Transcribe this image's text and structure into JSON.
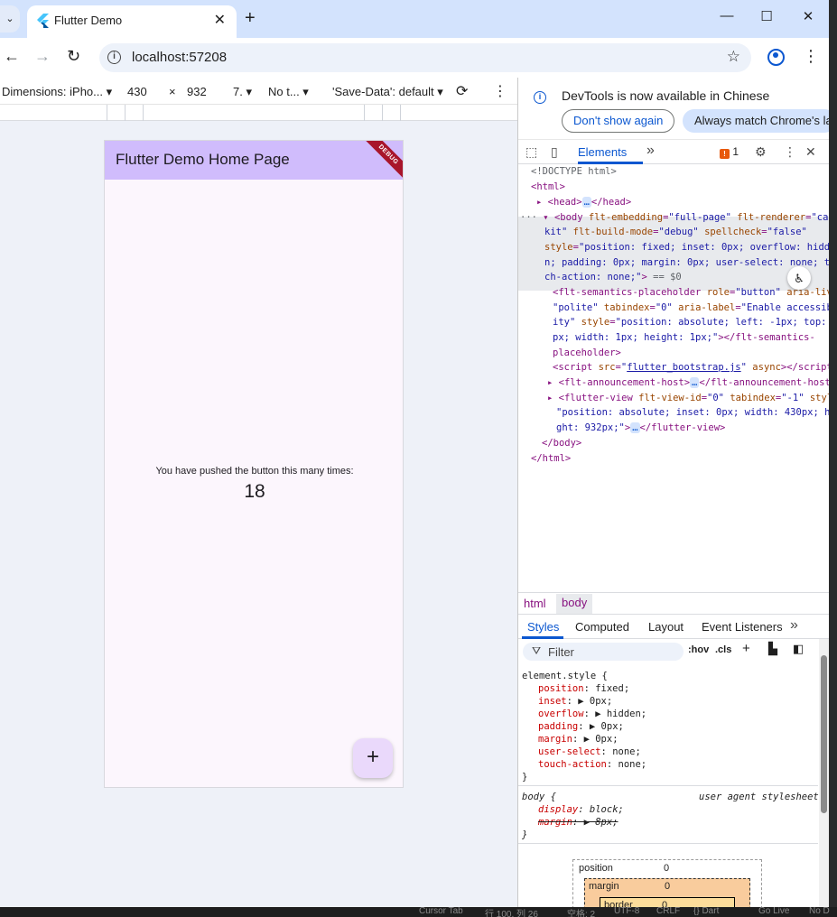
{
  "browser": {
    "tab_title": "Flutter Demo",
    "url": "localhost:57208"
  },
  "device_toolbar": {
    "dimensions": "Dimensions: iPho...",
    "width": "430",
    "times": "×",
    "height": "932",
    "zoom": "7.",
    "throttle": "No t...",
    "save_data": "'Save-Data': default"
  },
  "app": {
    "title": "Flutter Demo Home Page",
    "debug_banner": "DEBUG",
    "message": "You have pushed the button this many times:",
    "counter": "18",
    "fab_label": "+"
  },
  "devtools": {
    "banner_text": "DevTools is now available in Chinese",
    "dont_show": "Don't show again",
    "always_match": "Always match Chrome's language",
    "elements_tab": "Elements",
    "issues_count": "1",
    "crumbs": [
      "html",
      "body"
    ],
    "styles_tabs": [
      "Styles",
      "Computed",
      "Layout",
      "Event Listeners"
    ],
    "filter_placeholder": "Filter",
    "hov": ":hov",
    "cls": ".cls",
    "user_agent": "user agent stylesheet",
    "box_model": {
      "position_label": "position",
      "position_value": "0",
      "margin_label": "margin",
      "margin_value": "0",
      "border_label": "border",
      "border_value": "0"
    }
  },
  "taskbar": {
    "items": [
      "Cursor Tab",
      "行 100, 列 26",
      "空格: 2",
      "UTF-8",
      "CRLF",
      "{} Dart",
      "Go Live",
      "No D"
    ]
  },
  "colors": {
    "app_bar": "#d0bcfc",
    "fab": "#ead9fb",
    "accent": "#0b57d0"
  }
}
